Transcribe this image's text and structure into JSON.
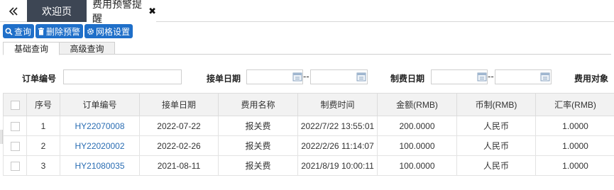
{
  "tabs": {
    "welcome": "欢迎页",
    "active": "费用预警提醒"
  },
  "toolbar": {
    "query": "查询",
    "delete": "删除预警",
    "grid_settings": "网格设置"
  },
  "subtabs": {
    "basic": "基础查询",
    "advanced": "高级查询"
  },
  "search": {
    "order_no_label": "订单编号",
    "order_no_value": "",
    "receive_date_label": "接单日期",
    "receive_date_from": "",
    "receive_date_to": "",
    "fee_date_label": "制费日期",
    "fee_date_from": "",
    "fee_date_to": "",
    "fee_object_label": "费用对象",
    "range_sep": "--"
  },
  "table": {
    "columns": [
      "序号",
      "订单编号",
      "接单日期",
      "费用名称",
      "制费时间",
      "金额(RMB)",
      "币制(RMB)",
      "汇率(RMB)"
    ],
    "rows": [
      {
        "seq": "1",
        "order_no": "HY22070008",
        "receive_date": "2022-07-22",
        "fee_name": "报关费",
        "fee_time": "2022/7/22 13:55:01",
        "amount": "200.0000",
        "currency": "人民币",
        "rate": "1.0000"
      },
      {
        "seq": "2",
        "order_no": "HY22020002",
        "receive_date": "2022-02-26",
        "fee_name": "报关费",
        "fee_time": "2022/2/26 11:14:07",
        "amount": "100.0000",
        "currency": "人民币",
        "rate": "1.0000"
      },
      {
        "seq": "3",
        "order_no": "HY21080035",
        "receive_date": "2021-08-11",
        "fee_name": "报关费",
        "fee_time": "2021/8/19 10:00:11",
        "amount": "100.0000",
        "currency": "人民币",
        "rate": "1.0000"
      }
    ]
  },
  "colors": {
    "tab_active_bg": "#3d4654",
    "button_blue": "#1f6fc9",
    "link_blue": "#2a6db3",
    "header_bg": "#f2f2f2"
  }
}
